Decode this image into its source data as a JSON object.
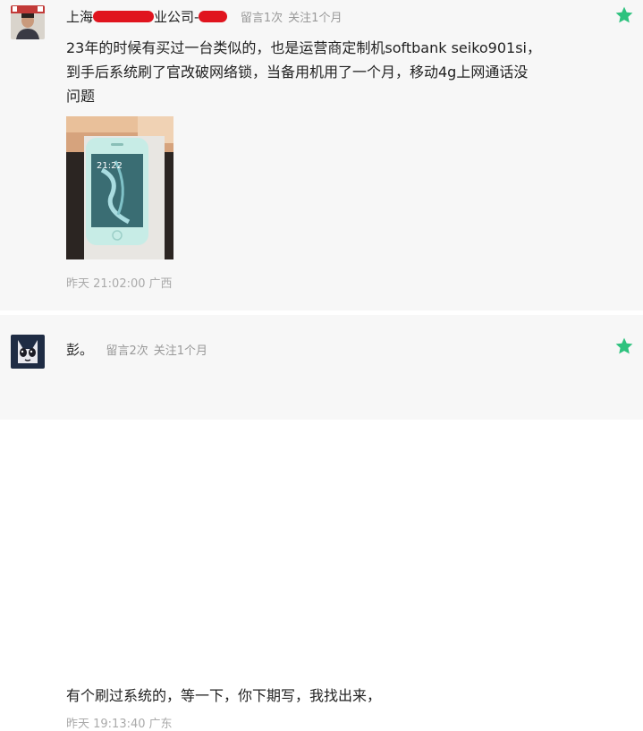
{
  "comments": [
    {
      "username_prefix": "上海",
      "username_mid": "业公司-",
      "meta_messages": "留言1次",
      "meta_follow": "关注1个月",
      "lines": [
        "23年的时候有买过一台类似的，也是运营商定制机softbank seiko901si，",
        "到手后系统刷了官改破网络锁，当备用机用了一个月，移动4g上网通话没",
        "问题"
      ],
      "photo": {
        "clock": "21:22",
        "device_color": "#c7ece6"
      },
      "time": "昨天 21:02:00",
      "location": "广西",
      "star_color": "#2ec27e"
    },
    {
      "username": "彭。",
      "meta_messages": "留言2次",
      "meta_follow": "关注1个月",
      "lines": [
        "有个刷过系统的，等一下，你下期写，我找出来，"
      ],
      "time": "昨天 19:13:40",
      "location": "广东",
      "star_color": "#2ec27e"
    }
  ],
  "icons": {
    "star": "star-icon",
    "avatar1": "user-avatar",
    "avatar2": "animal-avatar"
  },
  "colors": {
    "redaction": "#e0141e",
    "background": "#f7f7f7"
  }
}
